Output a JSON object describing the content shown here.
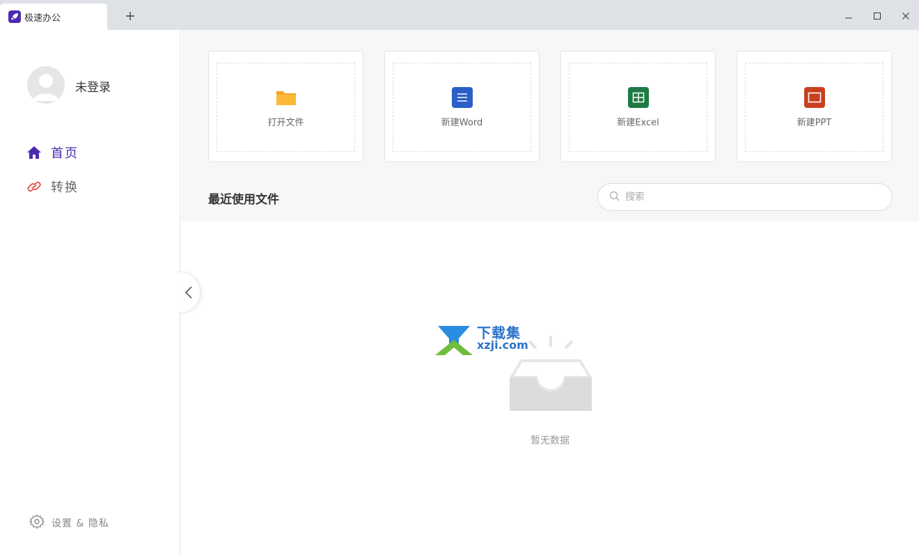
{
  "app": {
    "tab_title": "极速办公"
  },
  "user": {
    "name": "未登录"
  },
  "nav": {
    "home": "首页",
    "convert": "转换"
  },
  "settings": {
    "label": "设置 & 隐私"
  },
  "cards": [
    {
      "label": "打开文件",
      "icon": "folder-icon",
      "color": "#f5a623"
    },
    {
      "label": "新建Word",
      "icon": "word-doc-icon",
      "color": "#2b5fc7"
    },
    {
      "label": "新建Excel",
      "icon": "excel-sheet-icon",
      "color": "#1d7a45"
    },
    {
      "label": "新建PPT",
      "icon": "ppt-slide-icon",
      "color": "#c8401e"
    }
  ],
  "recent": {
    "title": "最近使用文件",
    "search_placeholder": "搜索",
    "empty_text": "暂无数据"
  },
  "watermark": {
    "cn": "下载集",
    "en": "xzji.com"
  },
  "colors": {
    "accent": "#4b2bb0",
    "convert_icon": "#e0504a"
  }
}
